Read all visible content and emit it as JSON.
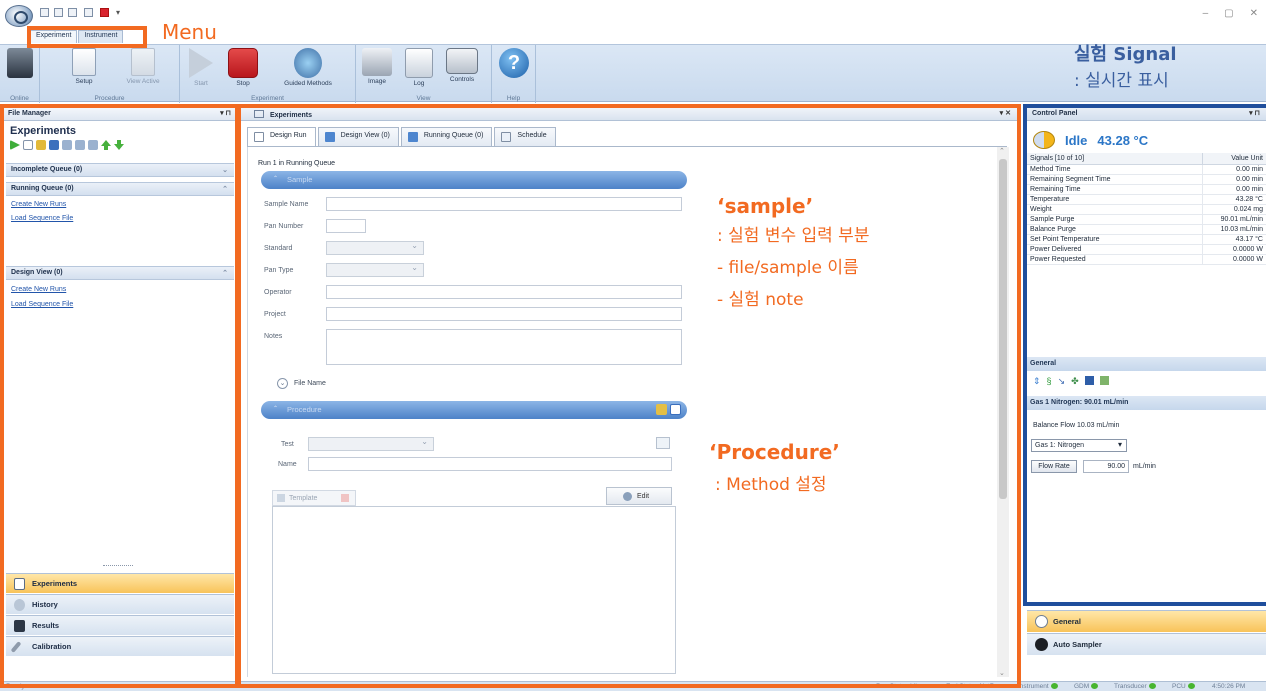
{
  "ribbon_tabs": [
    "Experiment",
    "Instrument"
  ],
  "window_controls": [
    "–",
    "▢",
    "✕"
  ],
  "ribbon": {
    "buttons": [
      {
        "label": "Setup"
      },
      {
        "label": "View Active"
      },
      {
        "label": "Start"
      },
      {
        "label": "Stop"
      },
      {
        "label": "Guided Methods"
      },
      {
        "label": "Image"
      },
      {
        "label": "Log"
      },
      {
        "label": "Controls"
      },
      {
        "label": "Help"
      }
    ],
    "groups": [
      "Online",
      "Procedure",
      "Experiment",
      "View",
      "Help"
    ]
  },
  "file_manager": {
    "header": "File Manager",
    "title": "Experiments",
    "incomplete_queue": "Incomplete Queue (0)",
    "running_queue": "Running Queue (0)",
    "design_view": "Design View (0)",
    "links": {
      "create": "Create New Runs",
      "load": "Load Sequence File"
    },
    "nav": [
      "Experiments",
      "History",
      "Results",
      "Calibration"
    ]
  },
  "experiments_panel": {
    "header": "Experiments",
    "tabs": [
      "Design Run",
      "Design View (0)",
      "Running Queue (0)",
      "Schedule"
    ],
    "run_label": "Run 1 in Running Queue",
    "sample_bar": "Sample",
    "fields": [
      "Sample Name",
      "Pan Number",
      "Standard",
      "Pan Type",
      "Operator",
      "Project",
      "Notes"
    ],
    "file_name": "File Name",
    "procedure_bar": "Procedure",
    "test_label": "Test",
    "name_label": "Name",
    "template_label": "Template",
    "edit_label": "Edit"
  },
  "control_panel": {
    "header": "Control Panel",
    "status": "Idle",
    "temperature": "43.28 °C",
    "table_header": {
      "signal": "Signals [10 of 10]",
      "value": "Value  Unit"
    },
    "signals": [
      {
        "name": "Method Time",
        "value": "0.00 min"
      },
      {
        "name": "Remaining Segment Time",
        "value": "0.00 min"
      },
      {
        "name": "Remaining Time",
        "value": "0.00 min"
      },
      {
        "name": "Temperature",
        "value": "43.28 °C"
      },
      {
        "name": "Weight",
        "value": "0.024 mg"
      },
      {
        "name": "Sample Purge",
        "value": "90.01 mL/min"
      },
      {
        "name": "Balance Purge",
        "value": "10.03 mL/min"
      },
      {
        "name": "Set Point Temperature",
        "value": "43.17 °C"
      },
      {
        "name": "Power Delivered",
        "value": "0.0000 W"
      },
      {
        "name": "Power Requested",
        "value": "0.0000 W"
      }
    ],
    "general_header": "General",
    "gas_header": "Gas 1 Nitrogen:  90.01 mL/min",
    "balance_flow": "Balance Flow   10.03 mL/min",
    "gas_select": "Gas 1: Nitrogen",
    "flow_rate_button": "Flow Rate",
    "flow_rate_value": "90.00",
    "flow_rate_unit": "mL/min",
    "nav": [
      "General",
      "Auto Sampler"
    ]
  },
  "statusbar": {
    "ready": "Ready",
    "run_status": "Run Status Idle",
    "end_status": "End Status NotRun",
    "instrument": "Instrument",
    "gdm": "GDM",
    "transducer": "Transducer",
    "pcu": "PCU",
    "time": "4:50:26 PM"
  },
  "annotations": {
    "menu": "Menu",
    "signal_title": "실험 Signal",
    "signal_sub": ": 실시간 표시",
    "sample_title": "‘sample’",
    "sample_lines": [
      ": 실험 변수 입력 부분",
      "- file/sample 이름",
      "- 실험 note"
    ],
    "procedure_title": "‘Procedure’",
    "procedure_sub": ": Method 설정"
  },
  "colors": {
    "annotation": "#f26a21",
    "accent_blue": "#2b76c7",
    "active_nav": "#f8c35a"
  }
}
